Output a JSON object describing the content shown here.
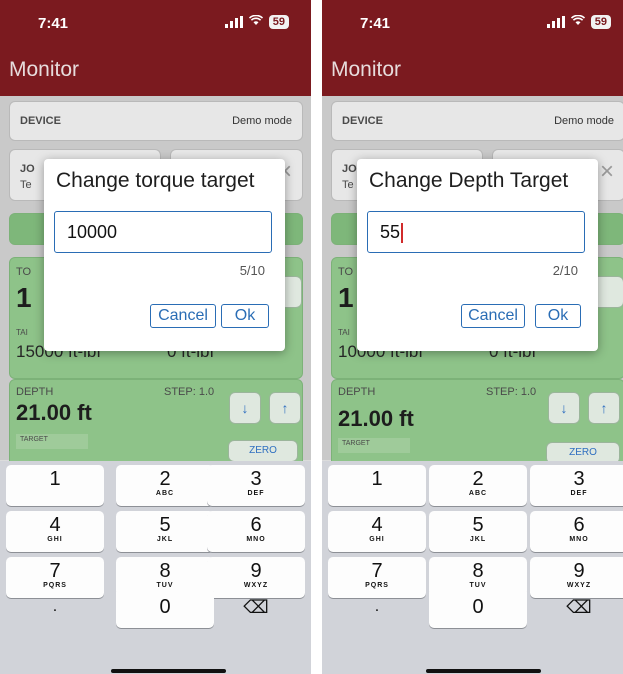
{
  "screens": [
    {
      "status_time": "7:41",
      "battery": "59",
      "nav_title": "Monitor",
      "device_label": "DEVICE",
      "device_mode": "Demo mode",
      "job_label": "JO",
      "job_value": "Te",
      "close_glyph": "×",
      "torque_label": "TO",
      "torque_value": "1",
      "torque_target_label": "TAI",
      "torque_target": "15000 ft-lbf",
      "torque_current": "0 ft-lbf",
      "depth_label": "DEPTH",
      "step": "STEP: 1.0",
      "depth_value": "21.00 ft",
      "target_label": "TARGET",
      "zero_label": "ZERO",
      "down": "↓",
      "up": "↑",
      "dialog": {
        "title": "Change torque target",
        "input_value": "10000",
        "counter": "5/10",
        "cancel_label": "Cancel",
        "ok_label": "Ok"
      }
    },
    {
      "status_time": "7:41",
      "battery": "59",
      "nav_title": "Monitor",
      "device_label": "DEVICE",
      "device_mode": "Demo mode",
      "job_label": "JO",
      "job_value": "Te",
      "close_glyph": "×",
      "torque_label": "TO",
      "torque_value": "1",
      "torque_target_label": "TAI",
      "torque_target": "10000 ft-lbf",
      "torque_current": "0 ft-lbf",
      "depth_label": "DEPTH",
      "step": "STEP: 1.0",
      "depth_value": "21.00 ft",
      "target_label": "TARGET",
      "zero_label": "ZERO",
      "down": "↓",
      "up": "↑",
      "dialog": {
        "title": "Change Depth Target",
        "input_value": "55",
        "counter": "2/10",
        "cancel_label": "Cancel",
        "ok_label": "Ok"
      }
    }
  ],
  "keyboard": {
    "keys": [
      {
        "num": "1",
        "letters": ""
      },
      {
        "num": "2",
        "letters": "ABC"
      },
      {
        "num": "3",
        "letters": "DEF"
      },
      {
        "num": "4",
        "letters": "GHI"
      },
      {
        "num": "5",
        "letters": "JKL"
      },
      {
        "num": "6",
        "letters": "MNO"
      },
      {
        "num": "7",
        "letters": "PQRS"
      },
      {
        "num": "8",
        "letters": "TUV"
      },
      {
        "num": "9",
        "letters": "WXYZ"
      },
      {
        "num": ".",
        "letters": ""
      },
      {
        "num": "0",
        "letters": ""
      },
      {
        "num": "⌫",
        "letters": ""
      }
    ]
  }
}
